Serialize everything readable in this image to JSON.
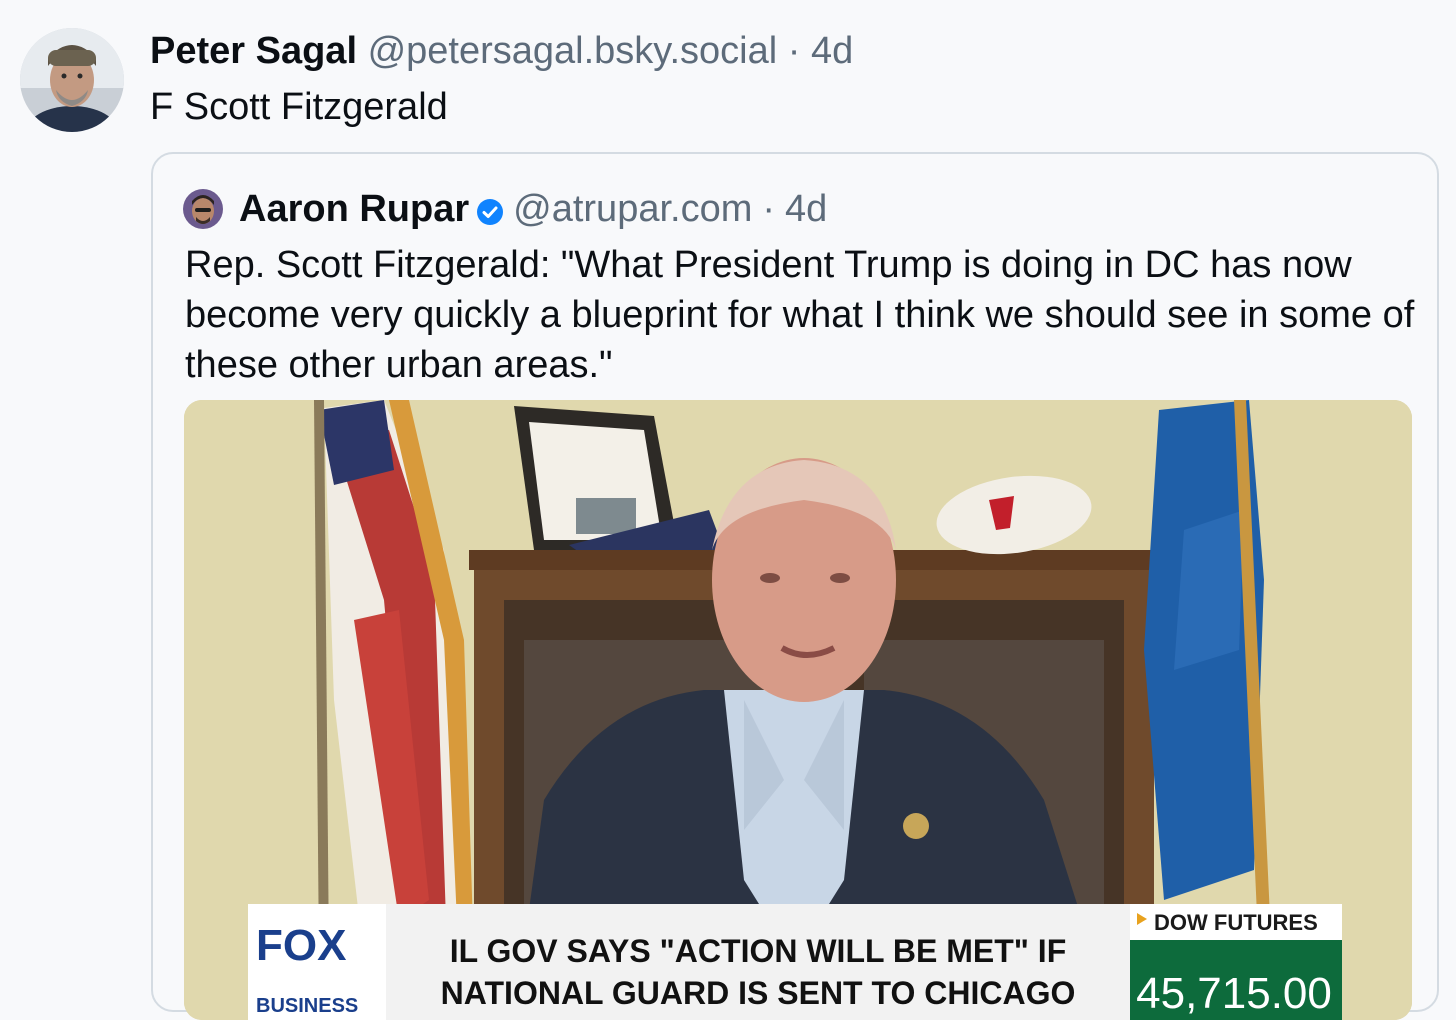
{
  "post": {
    "author_name": "Peter Sagal",
    "author_handle": "@petersagal.bsky.social",
    "separator": "·",
    "time": "4d",
    "text": "F Scott Fitzgerald"
  },
  "quote": {
    "author_name": "Aaron Rupar",
    "author_handle": "@atrupar.com",
    "separator": "·",
    "time": "4d",
    "text": "Rep. Scott Fitzgerald: \"What President Trump is doing in DC has now become very quickly a blueprint for what I think we should see in some of these other urban areas.\""
  },
  "video": {
    "network_logo": "FOX",
    "network_sub": "BUSINESS",
    "headline_line1": "IL GOV SAYS \"ACTION WILL BE MET\" IF",
    "headline_line2": "NATIONAL GUARD IS SENT TO CHICAGO",
    "ticker_label": "DOW FUTURES",
    "ticker_value": "45,715.00"
  },
  "icons": {
    "verified": "verified-badge-icon",
    "play_arrow": "triangle-right-icon"
  },
  "colors": {
    "verified": "#1083fe",
    "ticker_green": "#0d6b3c",
    "fox_blue": "#1a3f8c"
  }
}
